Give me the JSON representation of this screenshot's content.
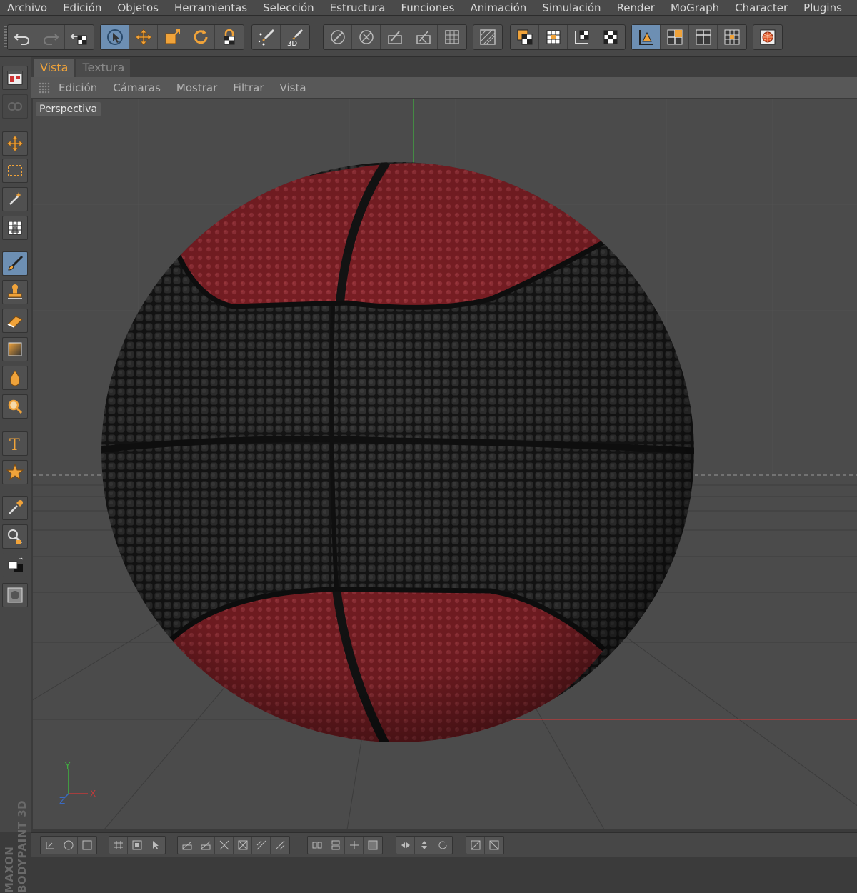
{
  "menu": [
    "Archivo",
    "Edición",
    "Objetos",
    "Herramientas",
    "Selección",
    "Estructura",
    "Funciones",
    "Animación",
    "Simulación",
    "Render",
    "MoGraph",
    "Character",
    "Plugins"
  ],
  "tabs": [
    {
      "label": "Vista",
      "active": true
    },
    {
      "label": "Textura",
      "active": false
    }
  ],
  "viewport_menu": [
    "Edición",
    "Cámaras",
    "Mostrar",
    "Filtrar",
    "Vista"
  ],
  "viewport": {
    "label": "Perspectiva",
    "axis": {
      "y": "Y",
      "x": "X",
      "z": "Z"
    }
  },
  "brand": {
    "line1": "MAXON",
    "line2": "BODYPAINT 3D"
  },
  "toolbar_groups": [
    {
      "name": "history",
      "icons": [
        "undo-icon",
        "redo-icon",
        "checker-undo-icon"
      ]
    },
    {
      "name": "transform",
      "icons": [
        "live-select-icon",
        "move-icon",
        "scale-icon",
        "rotate-icon",
        "lock-icon"
      ]
    },
    {
      "name": "paint",
      "icons": [
        "paint-stars-icon",
        "paint-3d-icon"
      ]
    },
    {
      "name": "uv",
      "icons": [
        "uv-1-icon",
        "uv-2-icon",
        "uv-3-icon",
        "uv-4-icon",
        "uv-grid-icon"
      ]
    },
    {
      "name": "mesh",
      "icons": [
        "mesh-icon"
      ]
    },
    {
      "name": "modes",
      "icons": [
        "mode-1-icon",
        "mode-2-icon",
        "mode-3-icon",
        "mode-4-icon"
      ]
    },
    {
      "name": "projection",
      "icons": [
        "projection-icon",
        "grid-4-icon",
        "grid-split-icon",
        "grid-multi-icon"
      ]
    },
    {
      "name": "render",
      "icons": [
        "render-globe-icon"
      ]
    }
  ],
  "left_tools": [
    "layout-icon",
    "layers-icon",
    "move-tool-icon",
    "rect-select-icon",
    "magic-wand-icon",
    "transform-icon",
    "brush-icon",
    "stamp-icon",
    "eraser-icon",
    "gradient-icon",
    "smudge-icon",
    "zoom-icon",
    "text-icon",
    "star-icon",
    "eyedropper-icon",
    "magnifier-icon",
    "color-swatch-icon",
    "mask-icon"
  ],
  "colors": {
    "accent": "#f0a33a",
    "active_tool": "#6d8fb3",
    "ball_red": "#8e2424",
    "ball_black": "#1c1c1c"
  }
}
